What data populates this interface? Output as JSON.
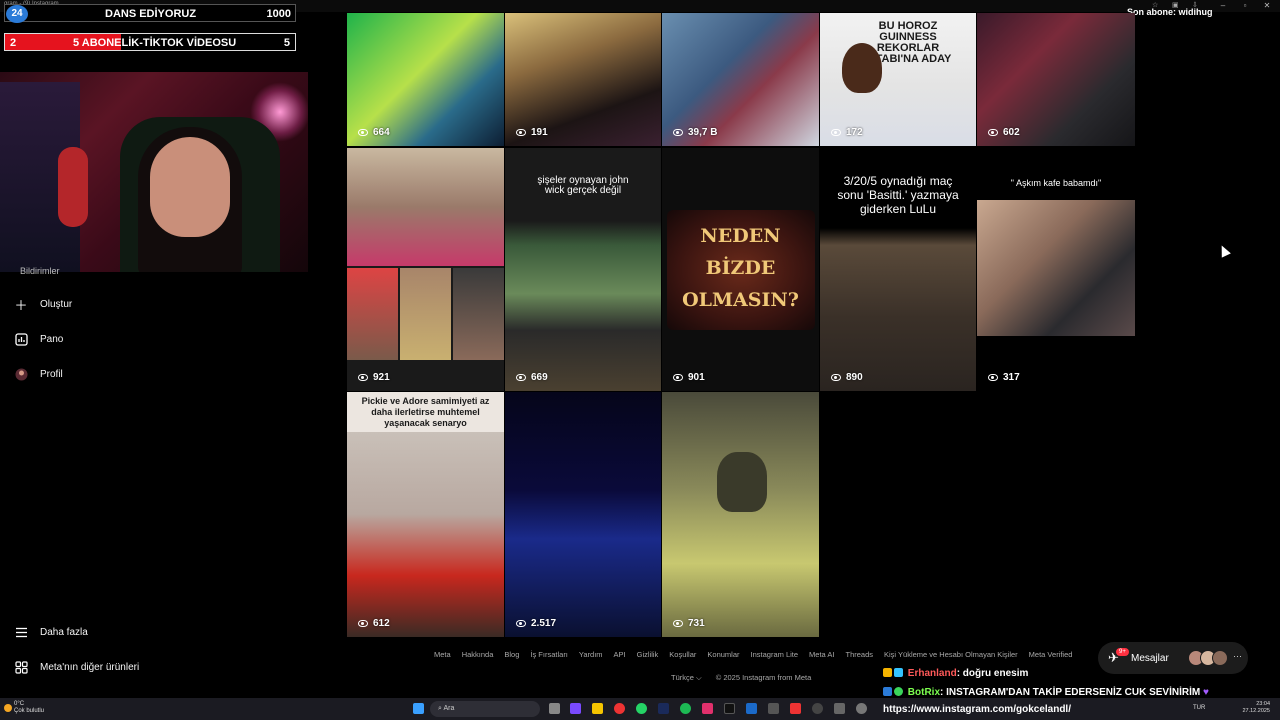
{
  "window": {
    "title": "gram - (9) Instagram"
  },
  "overlays": {
    "goal1": {
      "badge": "24",
      "text": "DANS EDİYORUZ",
      "value": "1000"
    },
    "goal2": {
      "left": "2",
      "text": "5 ABONELİK-TİKTOK VİDEOSU",
      "value": "5",
      "progress_fraction": 0.4
    },
    "sub_alert": "Son abone: widihug"
  },
  "sidebar": {
    "partial_label": "Bildirimler",
    "items": [
      {
        "label": "Oluştur",
        "icon": "plus-icon"
      },
      {
        "label": "Pano",
        "icon": "dashboard-icon"
      },
      {
        "label": "Profil",
        "icon": "profile-avatar-icon"
      }
    ],
    "bottom": [
      {
        "label": "Daha fazla",
        "icon": "menu-icon"
      },
      {
        "label": "Meta'nın diğer ürünleri",
        "icon": "meta-products-icon"
      }
    ]
  },
  "grid": {
    "tiles": [
      {
        "views": "664",
        "caption": ""
      },
      {
        "views": "191",
        "caption": ""
      },
      {
        "views": "39,7 B",
        "caption": ""
      },
      {
        "views": "172",
        "caption": "BU HOROZ GUINNESS REKORLAR KİTABI'NA ADAY"
      },
      {
        "views": "602",
        "caption": ""
      },
      {
        "views": "921",
        "caption": ""
      },
      {
        "views": "669",
        "caption": "şişeler oynayan john wick gerçek değil"
      },
      {
        "views": "901",
        "caption": "NEDEN BİZDE OLMASIN?"
      },
      {
        "views": "890",
        "caption": "3/20/5 oynadığı maç sonu 'Basitti.' yazmaya giderken LuLu"
      },
      {
        "views": "317",
        "caption": "\" Aşkım kafe babamdı\""
      },
      {
        "views": "612",
        "caption": "Pickie ve Adore samimiyeti az daha ilerletirse muhtemel yaşanacak senaryo"
      },
      {
        "views": "2.517",
        "caption": ""
      },
      {
        "views": "731",
        "caption": ""
      }
    ]
  },
  "footer": {
    "links": [
      "Meta",
      "Hakkında",
      "Blog",
      "İş Fırsatları",
      "Yardım",
      "API",
      "Gizlilik",
      "Koşullar",
      "Konumlar",
      "Instagram Lite",
      "Meta AI",
      "Threads",
      "Kişi Yükleme ve Hesabı Olmayan Kişiler",
      "Meta Verified"
    ],
    "language": "Türkçe",
    "copyright": "© 2025 Instagram from Meta"
  },
  "messages": {
    "label": "Mesajlar",
    "badge": "9+"
  },
  "chat": [
    {
      "user": "Erhanland",
      "text": ": doğru enesim",
      "color": "#ff5a5a"
    },
    {
      "user": "BotRix",
      "text": ": INSTAGRAM'DAN TAKİP EDERSENİZ CUK SEVİNİRİM",
      "color": "#7cff4f"
    },
    {
      "user": "",
      "text": "https://www.instagram.com/gokcelandl/",
      "color": "#ffffff"
    }
  ],
  "taskbar": {
    "weather_temp": "0°C",
    "weather_desc": "Çok bulutlu",
    "search_placeholder": "Ara",
    "lang": "TUR",
    "time": "23:04",
    "date": "27.12.2025"
  }
}
